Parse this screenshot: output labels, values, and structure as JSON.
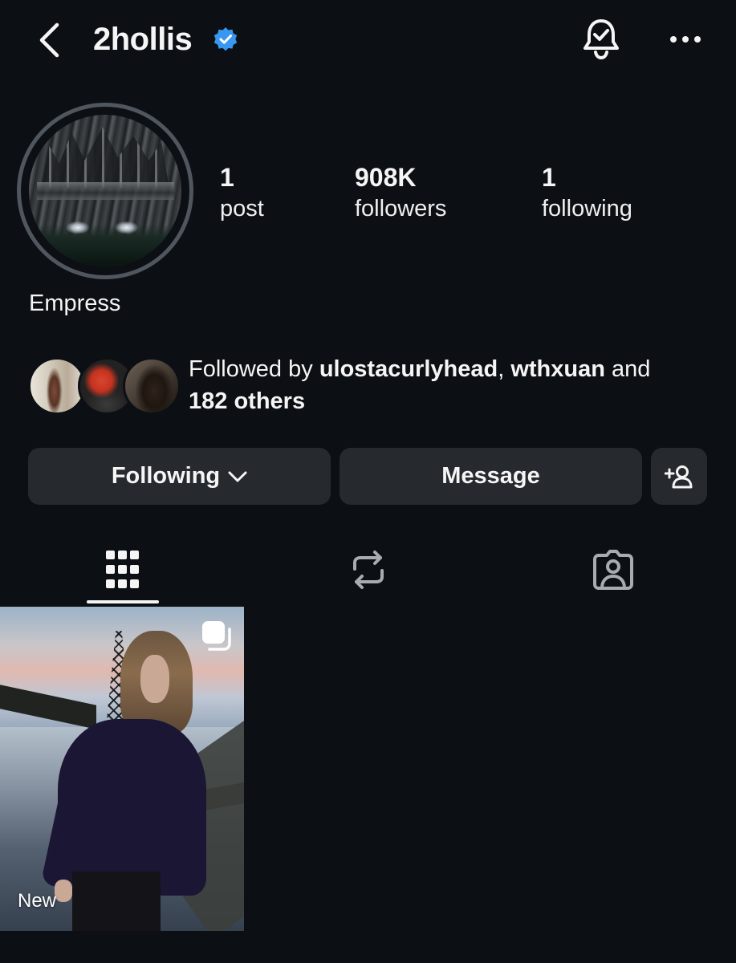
{
  "header": {
    "username": "2hollis",
    "verified": true,
    "icons": [
      "back-chevron-icon",
      "verified-badge-icon",
      "notification-bell-icon",
      "more-options-icon"
    ]
  },
  "profile": {
    "bio_name": "Empress",
    "stats": [
      {
        "value": "1",
        "label": "post"
      },
      {
        "value": "908K",
        "label": "followers"
      },
      {
        "value": "1",
        "label": "following"
      }
    ]
  },
  "followed_by": {
    "prefix": "Followed by ",
    "user1": "ulostacurlyhead",
    "separator": ", ",
    "user2": "wthxuan",
    "connector": " and",
    "others": "182 others"
  },
  "actions": {
    "following_label": "Following",
    "message_label": "Message",
    "add_user_icon": "add-person-icon"
  },
  "tabs": [
    {
      "name": "posts-grid",
      "icon": "grid-icon",
      "active": true
    },
    {
      "name": "reposts",
      "icon": "repost-icon",
      "active": false
    },
    {
      "name": "tagged",
      "icon": "tagged-person-icon",
      "active": false
    }
  ],
  "posts": [
    {
      "badge": "New",
      "multi": true
    }
  ],
  "colors": {
    "background": "#0c1014",
    "button": "#262a2f",
    "verified": "#3897f0",
    "text": "#f5f5f5"
  }
}
